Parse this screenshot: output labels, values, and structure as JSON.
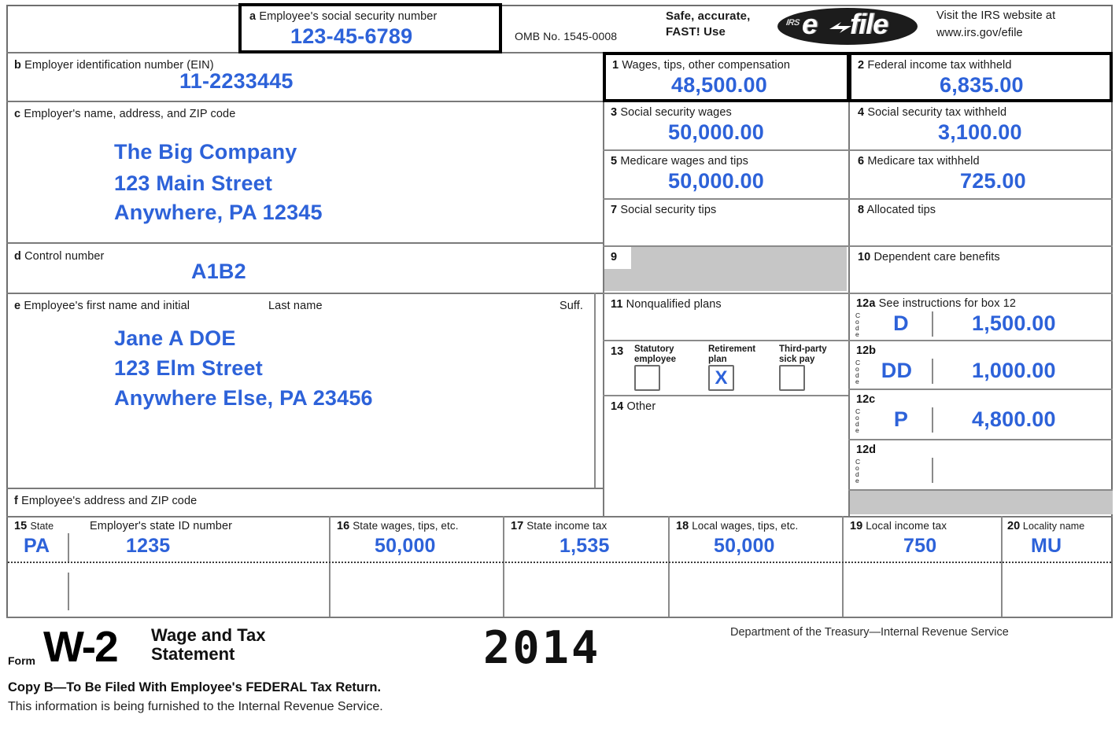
{
  "form": {
    "form_word": "Form",
    "form_number": "W-2",
    "form_title_line1": "Wage and Tax",
    "form_title_line2": "Statement",
    "year": "2014",
    "agency": "Department of the Treasury—Internal Revenue Service",
    "copy_line": "Copy B—To Be Filed With Employee's FEDERAL Tax Return.",
    "furnish_line": "This information is being furnished to the Internal Revenue Service.",
    "omb": "OMB No. 1545-0008",
    "efile_promo_line1": "Safe, accurate,",
    "efile_promo_line2": "FAST! Use",
    "efile_logo_irs": "IRS",
    "efile_logo_e": "e",
    "efile_logo_file": "file",
    "visit_line1": "Visit the IRS website at",
    "visit_line2": "www.irs.gov/efile"
  },
  "colors": {
    "entry_blue": "#2d62d9",
    "shade_gray": "#c6c6c6",
    "rule_gray": "#7a7a7a",
    "heavy_black": "#000000"
  },
  "boxes": {
    "a": {
      "letter": "a",
      "label": "Employee's social security number",
      "value": "123-45-6789"
    },
    "b": {
      "letter": "b",
      "label": "Employer identification number (EIN)",
      "value": "11-2233445"
    },
    "c": {
      "letter": "c",
      "label": "Employer's name, address, and ZIP code",
      "line1": "The Big Company",
      "line2": "123 Main Street",
      "line3": "Anywhere, PA 12345"
    },
    "d": {
      "letter": "d",
      "label": "Control number",
      "value": "A1B2"
    },
    "e": {
      "letter": "e",
      "label": "Employee's first name and initial",
      "label_last": "Last name",
      "label_suffix": "Suff.",
      "line1": "Jane A      DOE",
      "line2": "123 Elm Street",
      "line3": "Anywhere Else, PA 23456"
    },
    "f": {
      "letter": "f",
      "label": "Employee's address and ZIP code"
    },
    "1": {
      "num": "1",
      "label": "Wages, tips, other compensation",
      "value": "48,500.00"
    },
    "2": {
      "num": "2",
      "label": "Federal income tax withheld",
      "value": "6,835.00"
    },
    "3": {
      "num": "3",
      "label": "Social security wages",
      "value": "50,000.00"
    },
    "4": {
      "num": "4",
      "label": "Social security tax withheld",
      "value": "3,100.00"
    },
    "5": {
      "num": "5",
      "label": "Medicare wages and tips",
      "value": "50,000.00"
    },
    "6": {
      "num": "6",
      "label": "Medicare tax withheld",
      "value": "725.00"
    },
    "7": {
      "num": "7",
      "label": "Social security tips",
      "value": ""
    },
    "8": {
      "num": "8",
      "label": "Allocated tips",
      "value": ""
    },
    "9": {
      "num": "9",
      "label": "",
      "value": ""
    },
    "10": {
      "num": "10",
      "label": "Dependent care benefits",
      "value": ""
    },
    "11": {
      "num": "11",
      "label": "Nonqualified plans",
      "value": ""
    },
    "12a": {
      "num": "12a",
      "label": "See instructions for box 12",
      "code": "D",
      "value": "1,500.00"
    },
    "12b": {
      "num": "12b",
      "label": "",
      "code": "DD",
      "value": "1,000.00"
    },
    "12c": {
      "num": "12c",
      "label": "",
      "code": "P",
      "value": "4,800.00"
    },
    "12d": {
      "num": "12d",
      "label": "",
      "code": "",
      "value": ""
    },
    "13": {
      "num": "13",
      "checkboxes": [
        {
          "label": "Statutory\nemployee",
          "checked": "",
          "name": "statutory-employee"
        },
        {
          "label": "Retirement\nplan",
          "checked": "X",
          "name": "retirement-plan"
        },
        {
          "label": "Third-party\nsick pay",
          "checked": "",
          "name": "third-party-sick-pay"
        }
      ]
    },
    "14": {
      "num": "14",
      "label": "Other",
      "value": ""
    },
    "15": {
      "num": "15",
      "label_state": "State",
      "label_id": "Employer's state ID number",
      "state": "PA",
      "state_id": "1235",
      "state_row2": "",
      "state_id_row2": ""
    },
    "16": {
      "num": "16",
      "label": "State wages, tips, etc.",
      "value": "50,000",
      "row2": ""
    },
    "17": {
      "num": "17",
      "label": "State income tax",
      "value": "1,535",
      "row2": ""
    },
    "18": {
      "num": "18",
      "label": "Local wages, tips, etc.",
      "value": "50,000",
      "row2": ""
    },
    "19": {
      "num": "19",
      "label": "Local income tax",
      "value": "750",
      "row2": ""
    },
    "20": {
      "num": "20",
      "label": "Locality name",
      "value": "MU",
      "row2": ""
    }
  },
  "code_stack_letters": [
    "C",
    "o",
    "d",
    "e"
  ]
}
